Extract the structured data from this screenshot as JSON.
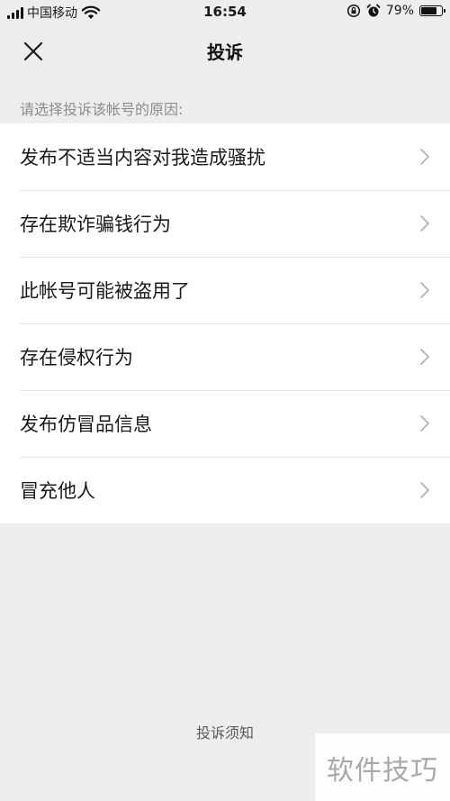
{
  "status_bar": {
    "carrier": "中国移动",
    "time": "16:54",
    "battery_percent": "79%",
    "battery_level": 0.79,
    "icons": [
      "signal-icon",
      "wifi-icon",
      "rotation-lock-icon",
      "alarm-icon",
      "battery-icon"
    ]
  },
  "nav": {
    "title": "投诉",
    "close_icon": "close-icon"
  },
  "hint": "请选择投诉该帐号的原因:",
  "reasons": [
    {
      "label": "发布不适当内容对我造成骚扰"
    },
    {
      "label": "存在欺诈骗钱行为"
    },
    {
      "label": "此帐号可能被盗用了"
    },
    {
      "label": "存在侵权行为"
    },
    {
      "label": "发布仿冒品信息"
    },
    {
      "label": "冒充他人"
    }
  ],
  "notice_link": "投诉须知",
  "watermark": "软件技巧",
  "colors": {
    "background": "#ededed",
    "list_background": "#ffffff",
    "hint_text": "#8c8c8c",
    "chevron": "#b2b2b2"
  }
}
